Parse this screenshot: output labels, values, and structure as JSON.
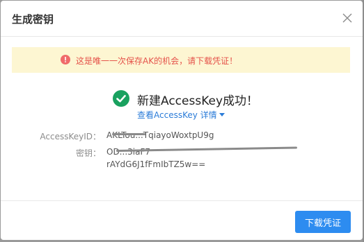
{
  "dialog": {
    "title": "生成密钥",
    "close_icon": "close-icon"
  },
  "alert": {
    "icon": "exclamation-circle-icon",
    "text": "这是唯一一次保存AK的机会，请下载凭证！",
    "color": "#e5534b",
    "background": "#fdf6d2"
  },
  "success": {
    "icon": "check-circle-icon",
    "text": "新建AccessKey成功！",
    "icon_color": "#19a15f",
    "link_text": "查看AccessKey 详情",
    "link_color": "#2b7cd8"
  },
  "fields": {
    "access_key_id_label": "AccessKeyID：",
    "access_key_id_value": "AKLTou...TqiayoWoxtpU9g",
    "secret_label": "密钥：",
    "secret_line1": "OD...3iaF7",
    "secret_line2": "rAYdG6J1fFmIbTZ5w=="
  },
  "footer": {
    "download_label": "下载凭证",
    "button_color": "#2d8cf0"
  }
}
